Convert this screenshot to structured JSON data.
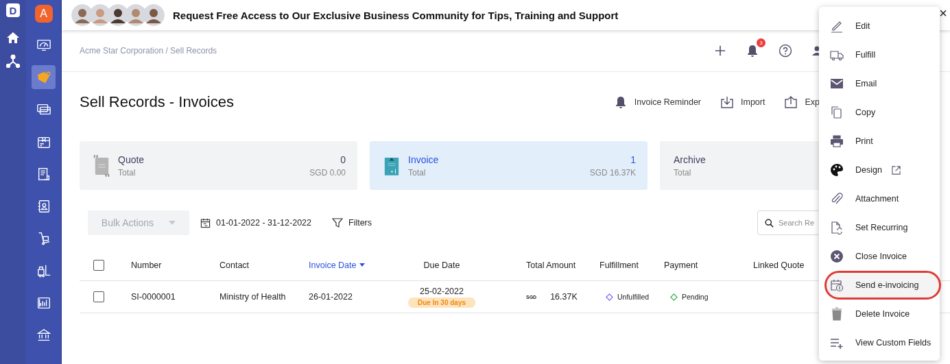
{
  "rail": {
    "logo": "D",
    "items": [
      {
        "kind": "home"
      },
      {
        "kind": "network"
      }
    ]
  },
  "sidebar": {
    "avatar": "A",
    "items": [
      {
        "kind": "dashboard",
        "selected": false
      },
      {
        "kind": "tag",
        "selected": true
      },
      {
        "kind": "cards",
        "selected": false
      },
      {
        "kind": "box",
        "selected": false
      },
      {
        "kind": "ledger",
        "selected": false
      },
      {
        "kind": "contact",
        "selected": false
      },
      {
        "kind": "trolley",
        "selected": false
      },
      {
        "kind": "forklift",
        "selected": false
      },
      {
        "kind": "report",
        "selected": false
      },
      {
        "kind": "bank",
        "selected": false
      }
    ]
  },
  "banner": {
    "text": "Request **Free Access** to Our Exclusive Business Community for Tips, Training and Support",
    "close": "×"
  },
  "header": {
    "breadcrumb": "Acme Star Corporation / Sell Records",
    "notifications": "3"
  },
  "page": {
    "title": "Sell Records - Invoices",
    "actions": [
      {
        "kind": "reminder",
        "label": "Invoice Reminder"
      },
      {
        "kind": "import",
        "label": "Import"
      },
      {
        "kind": "export",
        "label": "Exp"
      }
    ]
  },
  "cards": [
    {
      "kind": "quote",
      "title": "Quote",
      "subtitle": "Total",
      "count": "0",
      "amount": "SGD 0.00",
      "selected": false
    },
    {
      "kind": "invoice",
      "title": "Invoice",
      "subtitle": "Total",
      "count": "1",
      "amount": "SGD 16.37K",
      "selected": true
    },
    {
      "kind": "archive",
      "title": "Archive",
      "subtitle": "Total",
      "selected": false
    }
  ],
  "toolbar": {
    "bulk": {
      "label": "Bulk Actions",
      "disabled": true
    },
    "date_range": "01-01-2022 - 31-12-2022",
    "filters": "Filters",
    "search": {
      "placeholder": "Search Re"
    }
  },
  "table": {
    "columns": [
      {
        "label": "Number",
        "sorted": false
      },
      {
        "label": "Contact",
        "sorted": false
      },
      {
        "label": "Invoice Date",
        "sorted": true
      },
      {
        "label": "Due Date",
        "sorted": false
      },
      {
        "label": "Total Amount",
        "sorted": false
      },
      {
        "label": "Fulfillment",
        "sorted": false
      },
      {
        "label": "Payment",
        "sorted": false
      },
      {
        "label": "Linked Quote",
        "sorted": false
      }
    ],
    "header_checked": false,
    "rows": [
      {
        "checked": false,
        "number": "SI-0000001",
        "contact": "Ministry of Health",
        "invoice_date": "26-01-2022",
        "due_date": "25-02-2022",
        "due_badge": "Due In 30 days",
        "currency": "SGD",
        "amount": "16.37K",
        "fulfillment": "Unfulfilled",
        "payment": "Pending"
      }
    ]
  },
  "menu": {
    "items": [
      {
        "kind": "edit",
        "label": "Edit",
        "external": false,
        "highlighted": false
      },
      {
        "kind": "fulfill",
        "label": "Fulfill",
        "external": false,
        "highlighted": false
      },
      {
        "kind": "email",
        "label": "Email",
        "external": false,
        "highlighted": false
      },
      {
        "kind": "copy",
        "label": "Copy",
        "external": false,
        "highlighted": false
      },
      {
        "kind": "print",
        "label": "Print",
        "external": false,
        "highlighted": false
      },
      {
        "kind": "design",
        "label": "Design",
        "external": true,
        "highlighted": false
      },
      {
        "kind": "attachment",
        "label": "Attachment",
        "external": false,
        "highlighted": false
      },
      {
        "kind": "recurring",
        "label": "Set Recurring",
        "external": false,
        "highlighted": false
      },
      {
        "kind": "close",
        "label": "Close Invoice",
        "external": false,
        "highlighted": false
      },
      {
        "kind": "einvoice",
        "label": "Send e-invoicing",
        "external": false,
        "highlighted": true
      },
      {
        "kind": "delete",
        "label": "Delete Invoice",
        "external": false,
        "highlighted": false
      },
      {
        "kind": "fields",
        "label": "View Custom Fields",
        "external": false,
        "highlighted": false
      }
    ]
  }
}
